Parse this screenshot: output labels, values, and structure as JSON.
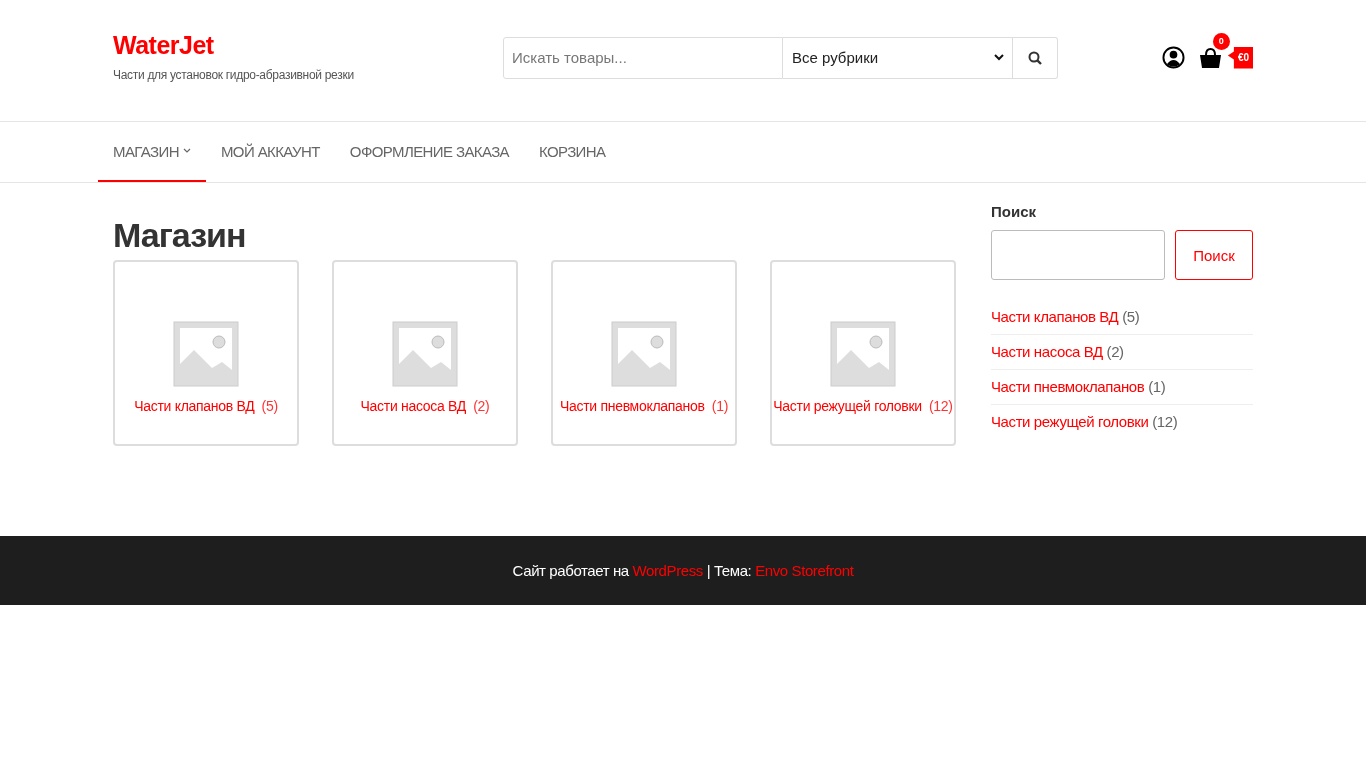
{
  "site": {
    "title": "WaterJet",
    "tagline": "Части для установок гидро-абразивной резки"
  },
  "search": {
    "placeholder": "Искать товары...",
    "category": "Все рубрики"
  },
  "cart": {
    "count": "0",
    "total": "€0"
  },
  "nav": [
    {
      "label": "МАГАЗИН",
      "selected": true,
      "dropdown": true
    },
    {
      "label": "МОЙ АККАУНТ",
      "selected": false,
      "dropdown": false
    },
    {
      "label": "ОФОРМЛЕНИЕ ЗАКАЗА",
      "selected": false,
      "dropdown": false
    },
    {
      "label": "КОРЗИНА",
      "selected": false,
      "dropdown": false
    }
  ],
  "page_title": "Магазин",
  "categories": [
    {
      "name": "Части клапанов ВД",
      "count": "(5)"
    },
    {
      "name": "Части насоса ВД",
      "count": "(2)"
    },
    {
      "name": "Части пневмоклапанов",
      "count": "(1)"
    },
    {
      "name": "Части режущей головки",
      "count": "(12)"
    }
  ],
  "sidebar": {
    "heading": "Поиск",
    "button": "Поиск",
    "categories": [
      {
        "name": "Части клапанов ВД",
        "count": "(5)"
      },
      {
        "name": "Части насоса ВД",
        "count": "(2)"
      },
      {
        "name": "Части пневмоклапанов",
        "count": "(1)"
      },
      {
        "name": "Части режущей головки",
        "count": "(12)"
      }
    ]
  },
  "footer": {
    "prefix": "Сайт работает на",
    "link": "WordPress",
    "separator": "| Тема:",
    "theme_link": "Envo Storefront"
  }
}
